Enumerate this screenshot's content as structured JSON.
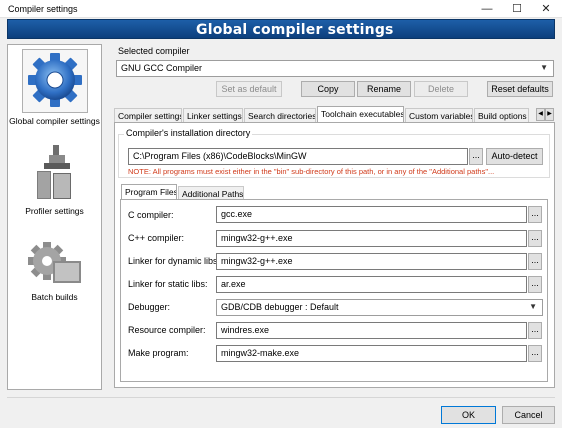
{
  "window": {
    "title": "Compiler settings",
    "minimize_glyph": "—",
    "maximize_glyph": "☐",
    "close_glyph": "✕"
  },
  "banner": {
    "text": "Global compiler settings"
  },
  "sidebar": {
    "items": [
      {
        "label": "Global compiler settings",
        "icon": "gear-icon",
        "selected": true
      },
      {
        "label": "Profiler settings",
        "icon": "profiler-icon",
        "selected": false
      },
      {
        "label": "Batch builds",
        "icon": "batch-builds-icon",
        "selected": false
      }
    ]
  },
  "selected_compiler": {
    "label": "Selected compiler",
    "value": "GNU GCC Compiler",
    "buttons": {
      "set_default": "Set as default",
      "copy": "Copy",
      "rename": "Rename",
      "delete": "Delete",
      "reset": "Reset defaults"
    }
  },
  "tabs": {
    "items": [
      "Compiler settings",
      "Linker settings",
      "Search directories",
      "Toolchain executables",
      "Custom variables",
      "Build options"
    ],
    "active": "Toolchain executables",
    "scroll_left": "◀",
    "scroll_right": "▶"
  },
  "install_dir": {
    "group_label": "Compiler's installation directory",
    "value": "C:\\Program Files (x86)\\CodeBlocks\\MinGW",
    "browse": "...",
    "autodetect": "Auto-detect",
    "note": "NOTE: All programs must exist either in the \"bin\" sub-directory of this path, or in any of the \"Additional paths\"..."
  },
  "subtabs": {
    "items": [
      "Program Files",
      "Additional Paths"
    ],
    "active": "Program Files"
  },
  "programs": {
    "browse": "...",
    "fields": [
      {
        "label": "C compiler:",
        "value": "gcc.exe"
      },
      {
        "label": "C++ compiler:",
        "value": "mingw32-g++.exe"
      },
      {
        "label": "Linker for dynamic libs:",
        "value": "mingw32-g++.exe"
      },
      {
        "label": "Linker for static libs:",
        "value": "ar.exe"
      },
      {
        "label": "Debugger:",
        "value": "GDB/CDB debugger : Default",
        "type": "select"
      },
      {
        "label": "Resource compiler:",
        "value": "windres.exe"
      },
      {
        "label": "Make program:",
        "value": "mingw32-make.exe"
      }
    ]
  },
  "footer": {
    "ok": "OK",
    "cancel": "Cancel"
  },
  "colors": {
    "banner": "#0d3f7d",
    "note": "#d03a1a",
    "focus_border": "#0078d7"
  }
}
